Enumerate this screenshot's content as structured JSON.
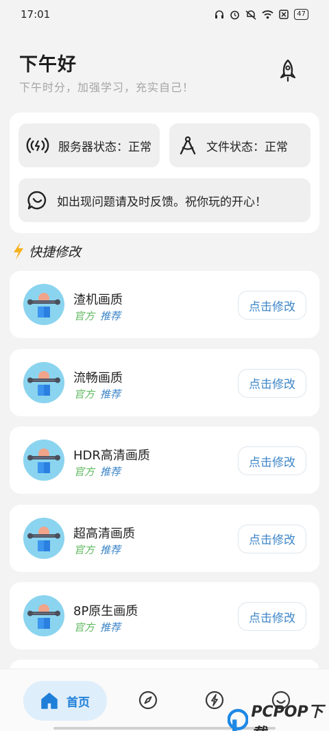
{
  "status_bar": {
    "time": "17:01",
    "battery": "47"
  },
  "header": {
    "greeting": "下午好",
    "subtitle": "下午时分，加强学习，充实自己！"
  },
  "status_card": {
    "server_status": "服务器状态：正常",
    "file_status": "文件状态：正常",
    "feedback": "如出现问题请及时反馈。祝你玩的开心！"
  },
  "quick_edit": {
    "section_title": "快捷修改",
    "items": [
      {
        "title": "渣机画质",
        "tag_official": "官方",
        "tag_recommend": "推荐",
        "button": "点击修改"
      },
      {
        "title": "流畅画质",
        "tag_official": "官方",
        "tag_recommend": "推荐",
        "button": "点击修改"
      },
      {
        "title": "HDR高清画质",
        "tag_official": "官方",
        "tag_recommend": "推荐",
        "button": "点击修改"
      },
      {
        "title": "超高清画质",
        "tag_official": "官方",
        "tag_recommend": "推荐",
        "button": "点击修改"
      },
      {
        "title": "8P原生画质",
        "tag_official": "官方",
        "tag_recommend": "推荐",
        "button": "点击修改"
      }
    ]
  },
  "bottom_nav": {
    "home_label": "首页",
    "icons": [
      "home-icon",
      "compass-icon",
      "lightning-icon",
      "smile-icon"
    ]
  },
  "watermark": {
    "text": "PCPOP下载"
  },
  "colors": {
    "accent": "#1f7fd8",
    "tag_green": "#5fb85f",
    "tag_blue": "#3e86c8",
    "avatar_bg": "#8bd4ef"
  }
}
